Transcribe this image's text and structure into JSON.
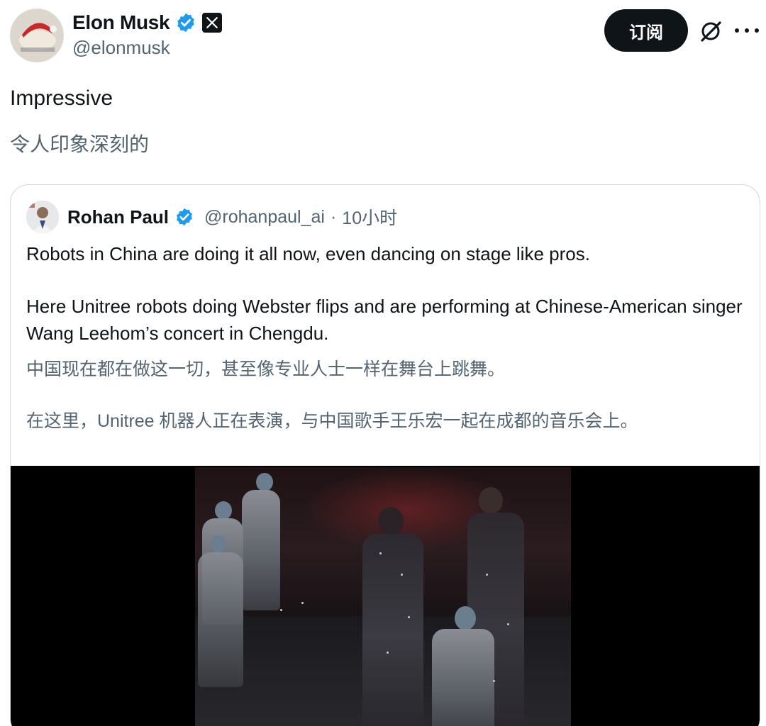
{
  "author": {
    "display_name": "Elon Musk",
    "handle": "@elonmusk",
    "avatar": "avatar-image",
    "verified_icon": "verified-badge-icon",
    "affiliate_icon": "x-logo-icon"
  },
  "actions": {
    "subscribe_label": "订阅",
    "grok_icon": "grok-icon",
    "more_icon": "more-options-icon"
  },
  "tweet": {
    "text": "Impressive",
    "translation": "令人印象深刻的"
  },
  "quote": {
    "display_name": "Rohan Paul",
    "handle": "@rohanpaul_ai",
    "separator": "·",
    "time": "10小时",
    "paragraph_1": "Robots in China are doing it all now, even dancing on stage like pros.",
    "paragraph_2": "Here Unitree robots doing Webster flips and are performing at Chinese-American singer Wang Leehom’s concert in Chengdu.",
    "translation_1": "中国现在都在做这一切，甚至像专业人士一样在舞台上跳舞。",
    "translation_2": "在这里，Unitree 机器人正在表演，与中国歌手王乐宏一起在成都的音乐会上。",
    "media": "video-thumbnail"
  },
  "colors": {
    "text_primary": "#0f1419",
    "text_secondary": "#536471",
    "verified": "#1d9bf0",
    "border": "#cfd9de",
    "button_bg": "#0f1419"
  }
}
